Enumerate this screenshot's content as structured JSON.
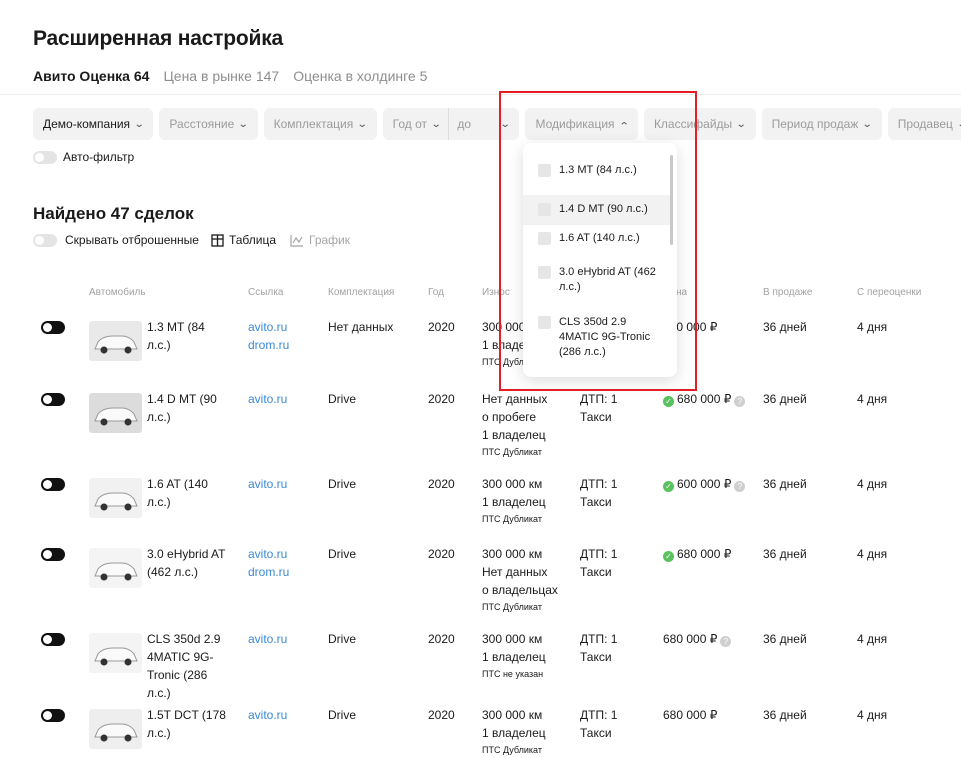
{
  "page_title": "Расширенная настройка",
  "tabs": [
    {
      "label": "Авито Оценка 64",
      "active": true
    },
    {
      "label": "Цена в рынке 147",
      "active": false
    },
    {
      "label": "Оценка в холдинге 5",
      "active": false
    }
  ],
  "filters": {
    "company": "Демо-компания",
    "distance": "Расстояние",
    "equipment": "Комплектация",
    "year_from": "Год от",
    "year_to": "до",
    "modification": "Модификация",
    "classifieds": "Классифайды",
    "sale_period": "Период продаж",
    "seller": "Продавец"
  },
  "auto_filter_label": "Авто-фильтр",
  "found_label": "Найдено 47 сделок",
  "view": {
    "hide_rejected": "Скрывать отброшенные",
    "table": "Таблица",
    "chart": "График"
  },
  "columns": {
    "car": "Автомобиль",
    "link": "Ссылка",
    "equipment": "Комплектация",
    "year": "Год",
    "wear": "Износ",
    "price": "Цена",
    "on_sale": "В продаже",
    "revaluation": "С переоценки"
  },
  "rows": [
    {
      "name": "1.3 MT (84 л.с.)",
      "links": [
        "avito.ru",
        "drom.ru"
      ],
      "equipment": "Нет данных",
      "year": "2020",
      "wear": [
        "300 000 км",
        "1 владелец"
      ],
      "pts": "ПТС Дубликат",
      "dtp": "",
      "usage": "",
      "price": "680 000 ₽",
      "price_ok": false,
      "price_q": false,
      "on_sale": "36 дней",
      "revaluation": "4 дня",
      "car_color": "#e9e9e9"
    },
    {
      "name": "1.4 D MT (90 л.с.)",
      "links": [
        "avito.ru"
      ],
      "equipment": "Drive",
      "year": "2020",
      "wear": [
        "Нет данных",
        "о пробеге",
        "1 владелец"
      ],
      "pts": "ПТС Дубликат",
      "dtp": "ДТП: 1",
      "usage": "Такси",
      "price": "680 000 ₽",
      "price_ok": true,
      "price_q": true,
      "on_sale": "36 дней",
      "revaluation": "4 дня",
      "car_color": "#dcdcdc"
    },
    {
      "name": "1.6 AT (140 л.с.)",
      "links": [
        "avito.ru"
      ],
      "equipment": "Drive",
      "year": "2020",
      "wear": [
        "300 000 км",
        "1 владелец"
      ],
      "pts": "ПТС Дубликат",
      "dtp": "ДТП: 1",
      "usage": "Такси",
      "price": "600 000 ₽",
      "price_ok": true,
      "price_q": true,
      "on_sale": "36 дней",
      "revaluation": "4 дня",
      "car_color": "#f1f1f1"
    },
    {
      "name": "3.0 eHybrid AT (462 л.с.)",
      "links": [
        "avito.ru",
        "drom.ru"
      ],
      "equipment": "Drive",
      "year": "2020",
      "wear": [
        "300 000 км",
        "Нет данных",
        "о владельцах"
      ],
      "pts": "ПТС Дубликат",
      "dtp": "ДТП: 1",
      "usage": "Такси",
      "price": "680 000 ₽",
      "price_ok": true,
      "price_q": false,
      "on_sale": "36 дней",
      "revaluation": "4 дня",
      "car_color": "#f4f4f4"
    },
    {
      "name": "CLS 350d 2.9 4MATIC 9G-Tronic (286 л.с.)",
      "links": [
        "avito.ru"
      ],
      "equipment": "Drive",
      "year": "2020",
      "wear": [
        "300 000 км",
        "1 владелец"
      ],
      "pts": "ПТС не указан",
      "dtp": "ДТП: 1",
      "usage": "Такси",
      "price": "680 000 ₽",
      "price_ok": false,
      "price_q": true,
      "on_sale": "36 дней",
      "revaluation": "4 дня",
      "car_color": "#f4f4f4"
    },
    {
      "name": "1.5T DCT (178 л.с.)",
      "links": [
        "avito.ru"
      ],
      "equipment": "Drive",
      "year": "2020",
      "wear": [
        "300 000 км",
        "1 владелец"
      ],
      "pts": "ПТС Дубликат",
      "dtp": "ДТП: 1",
      "usage": "Такси",
      "price": "680 000 ₽",
      "price_ok": false,
      "price_q": false,
      "on_sale": "36 дней",
      "revaluation": "4 дня",
      "car_color": "#eeeeee"
    }
  ],
  "dropdown_options": [
    {
      "label": "1.3 MT (84 л.с.)",
      "highlighted": false
    },
    {
      "label": "1.4 D MT (90 л.с.)",
      "highlighted": true
    },
    {
      "label": "1.6 AT (140 л.с.)",
      "highlighted": false
    },
    {
      "label": "3.0 eHybrid AT (462 л.с.)",
      "highlighted": false
    },
    {
      "label": "CLS 350d 2.9 4MATIC 9G-Tronic (286 л.с.)",
      "highlighted": false
    }
  ],
  "colors": {
    "accent_link": "#3a8ad8",
    "ok_badge": "#5ac15f",
    "highlight_box": "#e31e24",
    "switch_on": "#111111"
  }
}
